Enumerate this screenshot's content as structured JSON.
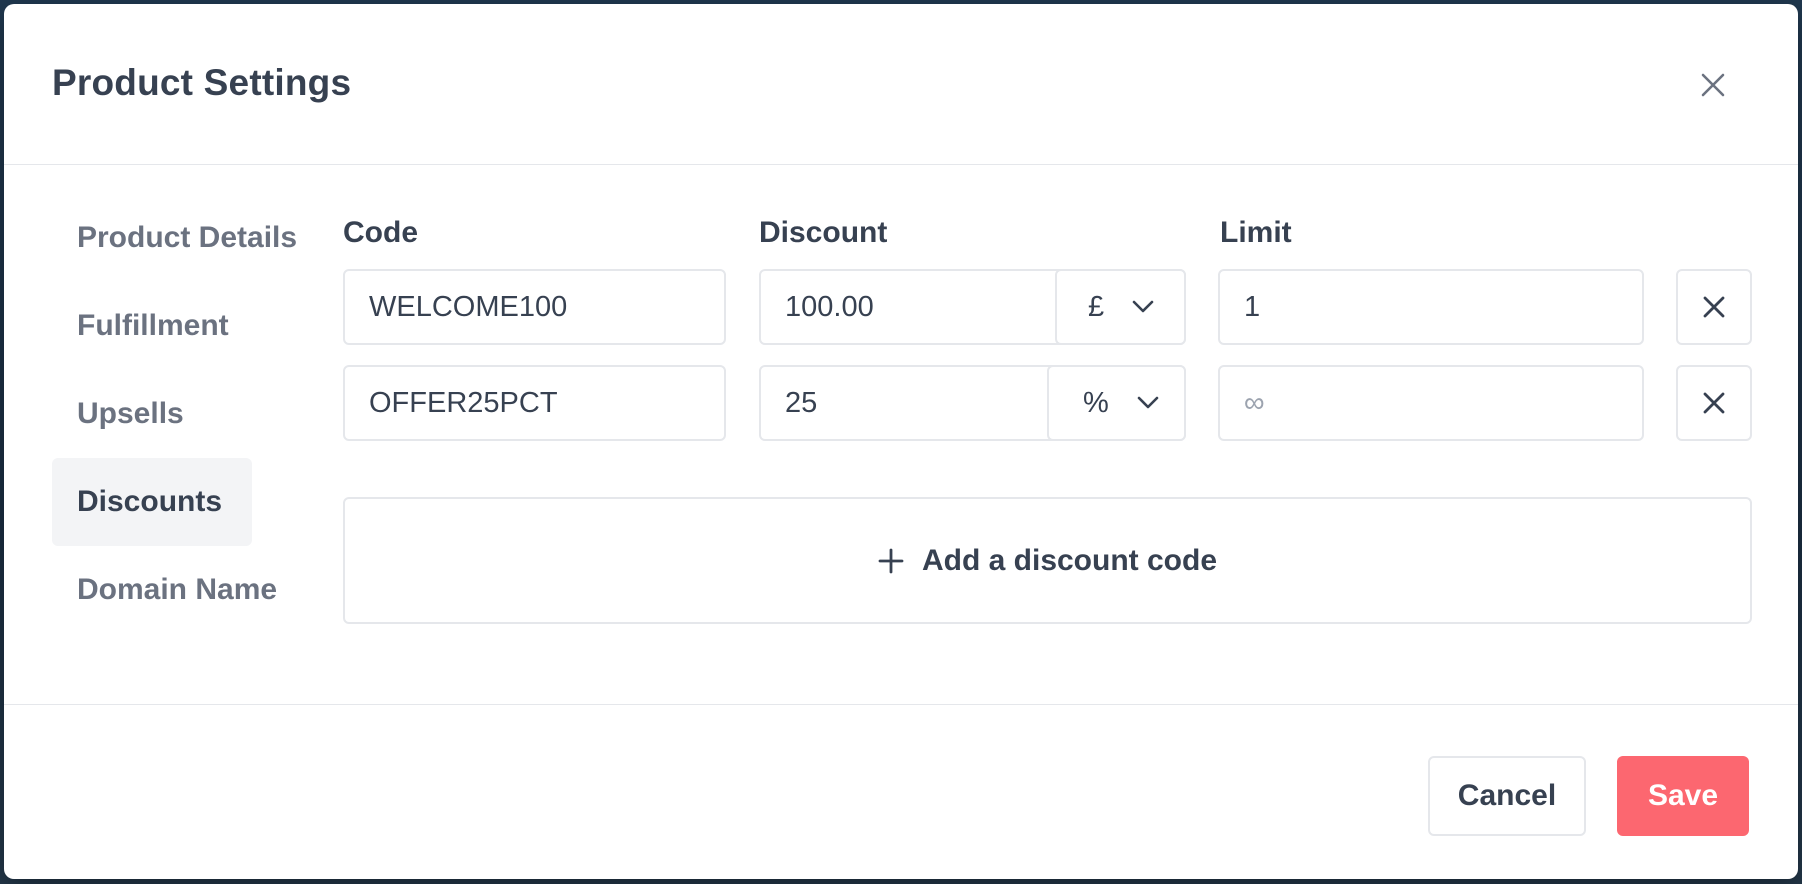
{
  "modal": {
    "title": "Product Settings"
  },
  "sidebar": {
    "items": [
      {
        "label": "Product Details"
      },
      {
        "label": "Fulfillment"
      },
      {
        "label": "Upsells"
      },
      {
        "label": "Discounts",
        "active": true
      },
      {
        "label": "Domain Name"
      }
    ]
  },
  "columns": {
    "code": "Code",
    "discount": "Discount",
    "limit": "Limit"
  },
  "discount_codes": [
    {
      "code": "WELCOME100",
      "amount": "100.00",
      "unit": "£",
      "limit": "1",
      "limit_placeholder": ""
    },
    {
      "code": "OFFER25PCT",
      "amount": "25",
      "unit": "%",
      "limit": "",
      "limit_placeholder": "∞"
    }
  ],
  "add_button": {
    "label": "Add a discount code"
  },
  "footer": {
    "cancel_label": "Cancel",
    "save_label": "Save"
  },
  "colors": {
    "accent": "#fc6770",
    "border": "#e5e7eb",
    "text": "#374151",
    "muted": "#6b7280",
    "active_bg": "#f3f4f6"
  },
  "icons": {
    "close": "close-icon",
    "dropdown": "chevron-down-icon",
    "remove": "close-icon",
    "add": "plus-icon"
  }
}
